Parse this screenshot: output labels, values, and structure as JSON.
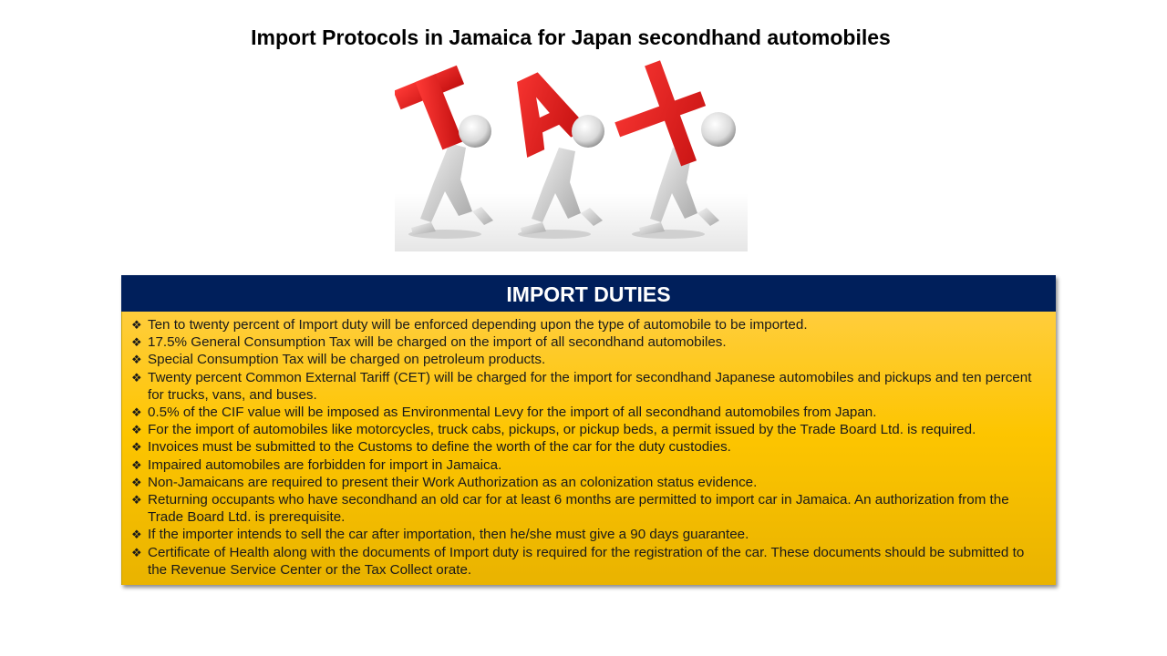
{
  "page": {
    "title": "Import Protocols in Jamaica for Japan secondhand automobiles"
  },
  "illustration": {
    "letters": [
      "T",
      "A",
      "X"
    ]
  },
  "panel": {
    "header": "IMPORT DUTIES",
    "bullet_glyph": "❖",
    "items": [
      "Ten to twenty percent of Import duty will be enforced depending upon the type of automobile to be imported.",
      "17.5% General Consumption Tax will be charged on the import of all secondhand automobiles.",
      "Special Consumption Tax will be charged on petroleum products.",
      "Twenty percent Common External Tariff (CET) will be charged for the import for secondhand Japanese automobiles and pickups and ten percent for trucks, vans, and buses.",
      "0.5% of the CIF value will be imposed as Environmental Levy for the import of all secondhand automobiles from Japan.",
      "For the import of automobiles like motorcycles, truck cabs, pickups, or pickup beds, a permit issued by the Trade Board Ltd. is required.",
      "Invoices must be submitted to the Customs to define the worth of the car for the duty custodies.",
      "Impaired automobiles are forbidden for import in Jamaica.",
      "Non-Jamaicans are required to present their Work Authorization as an colonization status evidence.",
      "Returning occupants who have secondhand an old car for at least 6 months are permitted to import car in Jamaica. An authorization from the Trade Board Ltd. is prerequisite.",
      "If the importer intends to sell the car after importation, then he/she must give a 90 days guarantee.",
      "Certificate of Health along with the documents of Import duty is required for the registration of the car. These documents should be submitted to the Revenue Service Center or the Tax Collect orate."
    ]
  },
  "colors": {
    "header_bg": "#001f5b",
    "panel_bg": "#fdc500",
    "letter_red": "#e8201f"
  }
}
